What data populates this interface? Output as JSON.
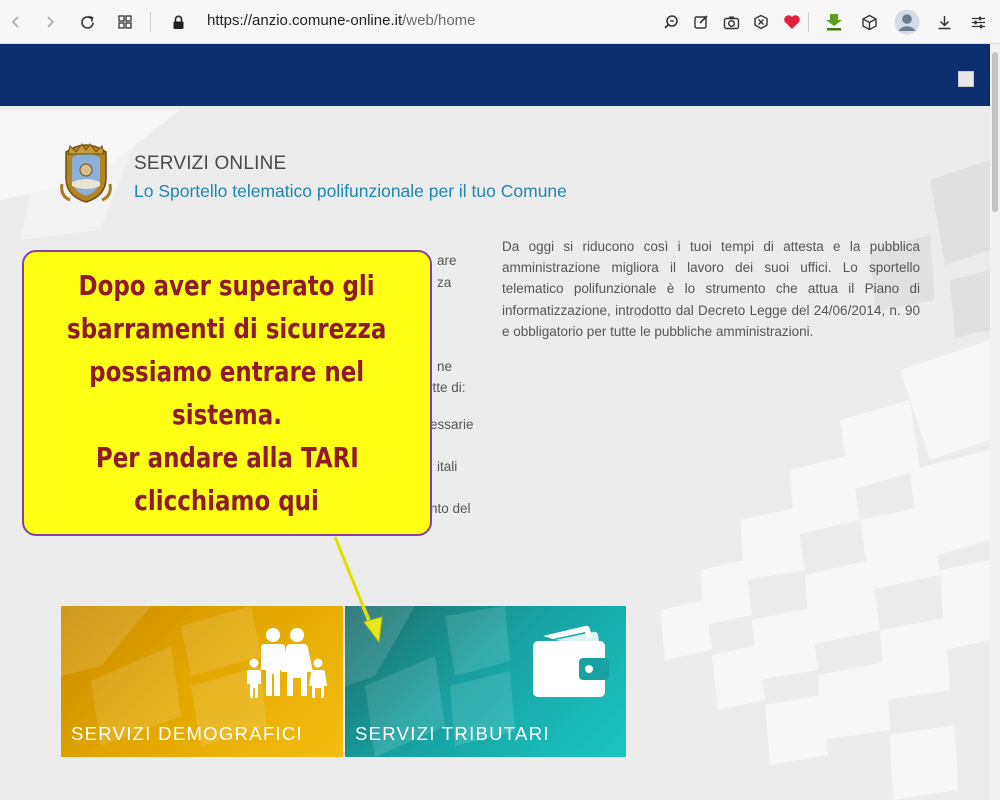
{
  "browser": {
    "url_host": "https://anzio.comune-online.it",
    "url_path": "/web/home",
    "icons": [
      "back-icon",
      "forward-icon",
      "reload-icon",
      "apps-grid-icon",
      "lock-icon",
      "zoom-icon",
      "edit-icon",
      "camera-icon",
      "shield-icon",
      "heart-icon",
      "download-arrow-icon",
      "cube-icon",
      "profile-icon",
      "downloads-icon",
      "settings-icon"
    ]
  },
  "brand": {
    "title": "SERVIZI ONLINE",
    "subtitle": "Lo Sportello telematico polifunzionale per il tuo Comune"
  },
  "intro": {
    "left": [
      "are",
      "za",
      "ne",
      "ette di:",
      "essarie",
      "itali",
      "nto del"
    ],
    "right": "Da oggi si riducono così i tuoi tempi di attesta e la pubblica amministrazione migliora il lavoro dei suoi uffici. Lo sportello telematico polifunzionale è lo strumento che attua il Piano di informatizzazione, introdotto dal Decreto Legge del 24/06/2014, n. 90 e obbligatorio per tutte le pubbliche amministrazioni."
  },
  "callout": {
    "lines": [
      "Dopo aver superato gli",
      "sbarramenti di sicurezza",
      "possiamo entrare nel",
      "sistema.",
      "Per andare alla TARI",
      "clicchiamo qui"
    ]
  },
  "tiles": {
    "demografici": {
      "label": "SERVIZI DEMOGRAFICI",
      "icon": "family-icon"
    },
    "tributari": {
      "label": "SERVIZI TRIBUTARI",
      "icon": "wallet-icon"
    }
  },
  "colors": {
    "header_blue": "#0d2e6f",
    "subtitle_blue": "#1f86b0",
    "callout_yellow": "#ffff16",
    "callout_text": "#8e1a2a",
    "tile_demo": "#e1a600",
    "tile_trib": "#17a1a0"
  }
}
